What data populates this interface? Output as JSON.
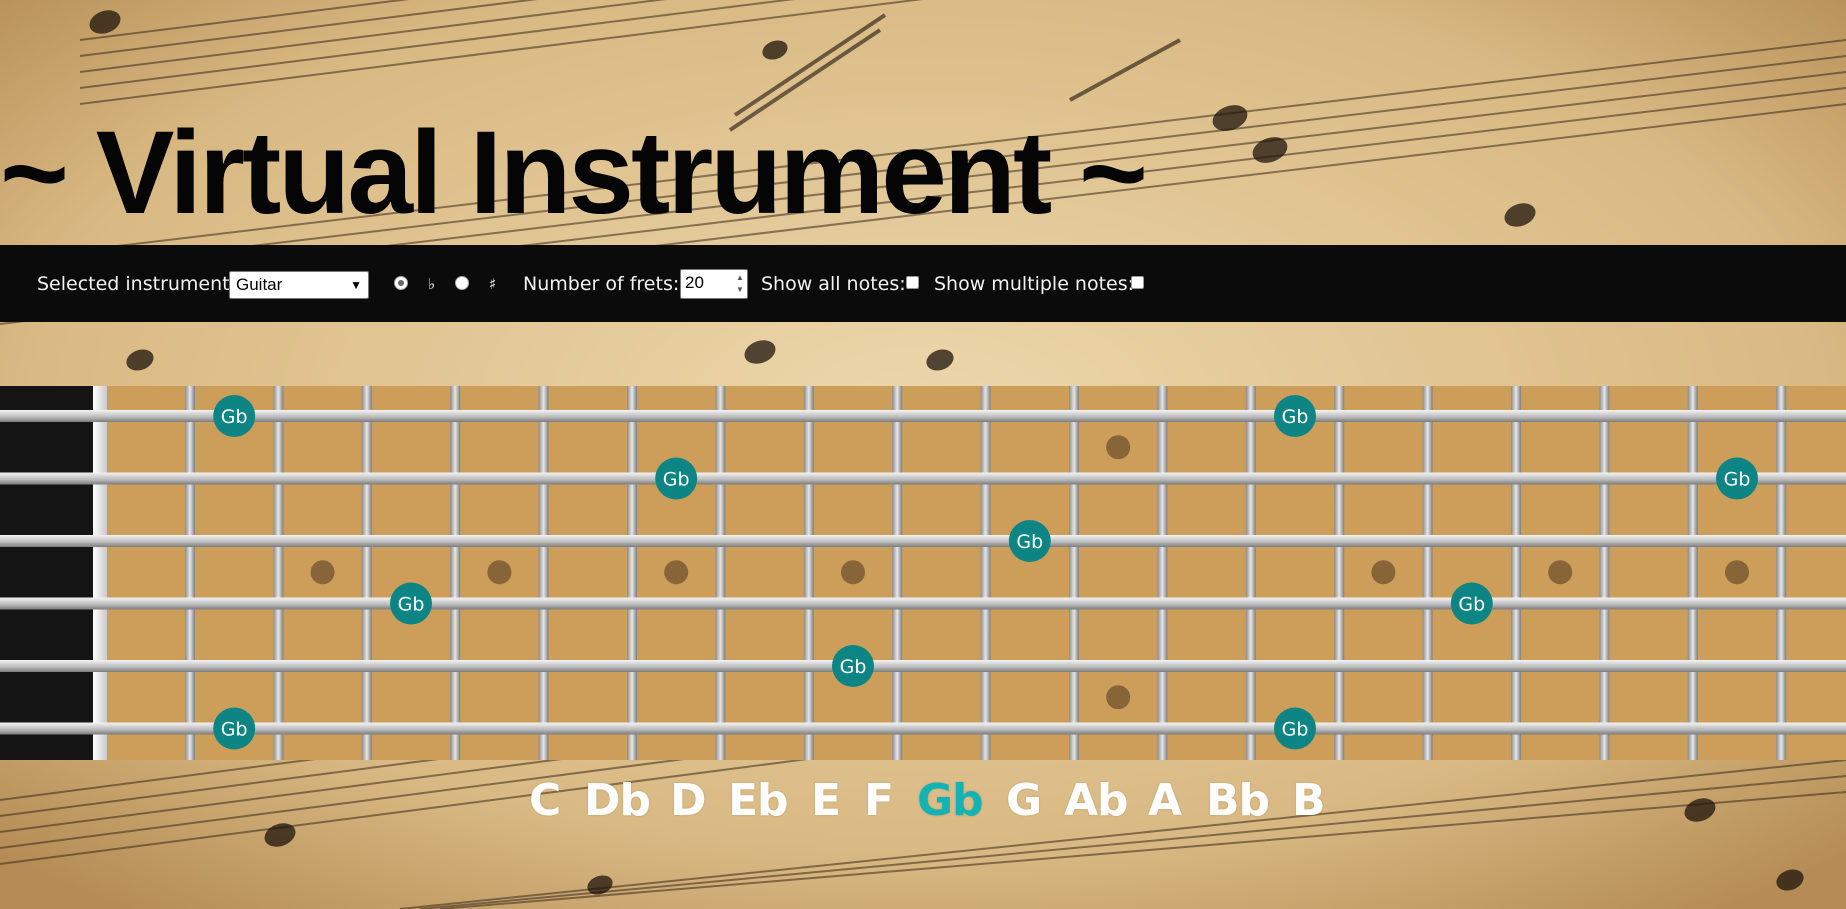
{
  "page": {
    "title": "~ Virtual Instrument ~"
  },
  "settings": {
    "instrument_label": "Selected instrument:",
    "instrument_value": "Guitar",
    "flat_symbol": "♭",
    "sharp_symbol": "♯",
    "accidental_selected": "flat",
    "frets_label": "Number of frets:",
    "frets_value": "20",
    "show_all_label": "Show all notes:",
    "show_all_checked": false,
    "show_multiple_label": "Show multiple notes:",
    "show_multiple_checked": false
  },
  "fretboard": {
    "frets": 20,
    "strings": 6,
    "selected_note": "Gb",
    "markers": [
      {
        "string": 1,
        "fret": 2,
        "label": "Gb"
      },
      {
        "string": 1,
        "fret": 14,
        "label": "Gb"
      },
      {
        "string": 2,
        "fret": 7,
        "label": "Gb"
      },
      {
        "string": 2,
        "fret": 19,
        "label": "Gb"
      },
      {
        "string": 3,
        "fret": 11,
        "label": "Gb"
      },
      {
        "string": 4,
        "fret": 4,
        "label": "Gb"
      },
      {
        "string": 4,
        "fret": 16,
        "label": "Gb"
      },
      {
        "string": 5,
        "fret": 9,
        "label": "Gb"
      },
      {
        "string": 6,
        "fret": 2,
        "label": "Gb"
      },
      {
        "string": 6,
        "fret": 14,
        "label": "Gb"
      }
    ],
    "inlay_frets": [
      3,
      5,
      7,
      9,
      15,
      17,
      19
    ],
    "double_inlay_fret": 12
  },
  "note_names": [
    "C",
    "Db",
    "D",
    "Eb",
    "E",
    "F",
    "Gb",
    "G",
    "Ab",
    "A",
    "Bb",
    "B"
  ],
  "colors": {
    "accent": "#0e8585",
    "accent_text": "#13b3b3",
    "board": "#cd9e5a",
    "nut_area": "#141414",
    "settings_bar": "#0b0b0b",
    "note_text": "#ffffff"
  }
}
